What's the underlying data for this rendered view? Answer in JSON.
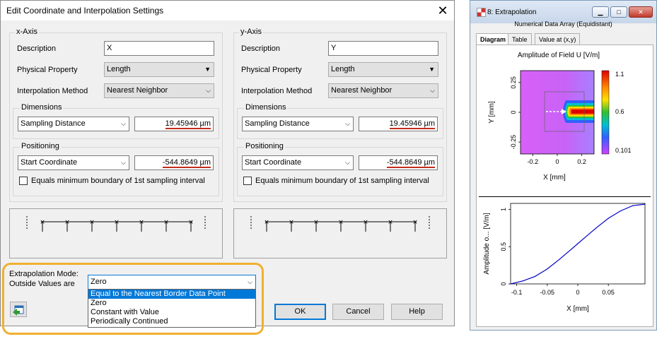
{
  "dialog": {
    "title": "Edit Coordinate and Interpolation Settings",
    "close_glyph": "✕",
    "x_axis": {
      "title": "x-Axis",
      "description_label": "Description",
      "description_value": "X",
      "physical_property_label": "Physical Property",
      "physical_property_value": "Length",
      "interp_label": "Interpolation Method",
      "interp_value": "Nearest Neighbor",
      "dimensions_title": "Dimensions",
      "dimensions_mode": "Sampling Distance",
      "dimensions_value": "19.45946 µm",
      "positioning_title": "Positioning",
      "positioning_mode": "Start Coordinate",
      "positioning_value": "-544.8649 µm",
      "equals_label": "Equals minimum boundary of 1st sampling interval"
    },
    "y_axis": {
      "title": "y-Axis",
      "description_label": "Description",
      "description_value": "Y",
      "physical_property_label": "Physical Property",
      "physical_property_value": "Length",
      "interp_label": "Interpolation Method",
      "interp_value": "Nearest Neighbor",
      "dimensions_title": "Dimensions",
      "dimensions_mode": "Sampling Distance",
      "dimensions_value": "19.45946 µm",
      "positioning_title": "Positioning",
      "positioning_mode": "Start Coordinate",
      "positioning_value": "-544.8649 µm",
      "equals_label": "Equals minimum boundary of 1st sampling interval"
    },
    "extrapolation": {
      "label_line1": "Extrapolation Mode:",
      "label_line2": "Outside Values are",
      "selected": "Zero",
      "options": [
        "Equal to the Nearest Border Data Point",
        "Zero",
        "Constant with Value",
        "Periodically Continued"
      ]
    },
    "ok_label": "OK",
    "cancel_label": "Cancel",
    "help_label": "Help"
  },
  "window": {
    "title": "8: Extrapolation",
    "subtitle": "Numerical Data Array (Equidistant)",
    "tabs": [
      "Diagram",
      "Table",
      "Value at (x,y)"
    ],
    "colorbar_ticks": [
      "1.1",
      "0.6",
      "0.101"
    ],
    "colors": {
      "accent": "#0078d7",
      "highlight": "#f0b030",
      "line": "#0000cc"
    }
  },
  "chart_data": [
    {
      "type": "heatmap",
      "title": "Amplitude of Field U  [V/m]",
      "xlabel": "X [mm]",
      "ylabel": "Y [mm]",
      "x_ticks": [
        "-0.2",
        "0",
        "0.2"
      ],
      "y_ticks": [
        "0.25",
        "0",
        "-0.25"
      ],
      "xlim": [
        -0.3,
        0.3
      ],
      "ylim": [
        -0.35,
        0.35
      ],
      "colorbar_range": [
        0.101,
        1.1
      ]
    },
    {
      "type": "line",
      "xlabel": "X [mm]",
      "ylabel": "Amplitude o... [V/m]",
      "x_ticks": [
        "-0.1",
        "-0.05",
        "0",
        "0.05"
      ],
      "y_ticks": [
        "1",
        "0.5",
        "0"
      ],
      "xlim": [
        -0.11,
        0.11
      ],
      "ylim": [
        0,
        1.08
      ],
      "x": [
        -0.11,
        -0.09,
        -0.07,
        -0.05,
        -0.03,
        -0.01,
        0.0,
        0.01,
        0.03,
        0.05,
        0.07,
        0.09,
        0.11
      ],
      "y": [
        0.0,
        0.04,
        0.1,
        0.2,
        0.33,
        0.47,
        0.54,
        0.61,
        0.75,
        0.88,
        0.98,
        1.05,
        1.07
      ]
    }
  ]
}
